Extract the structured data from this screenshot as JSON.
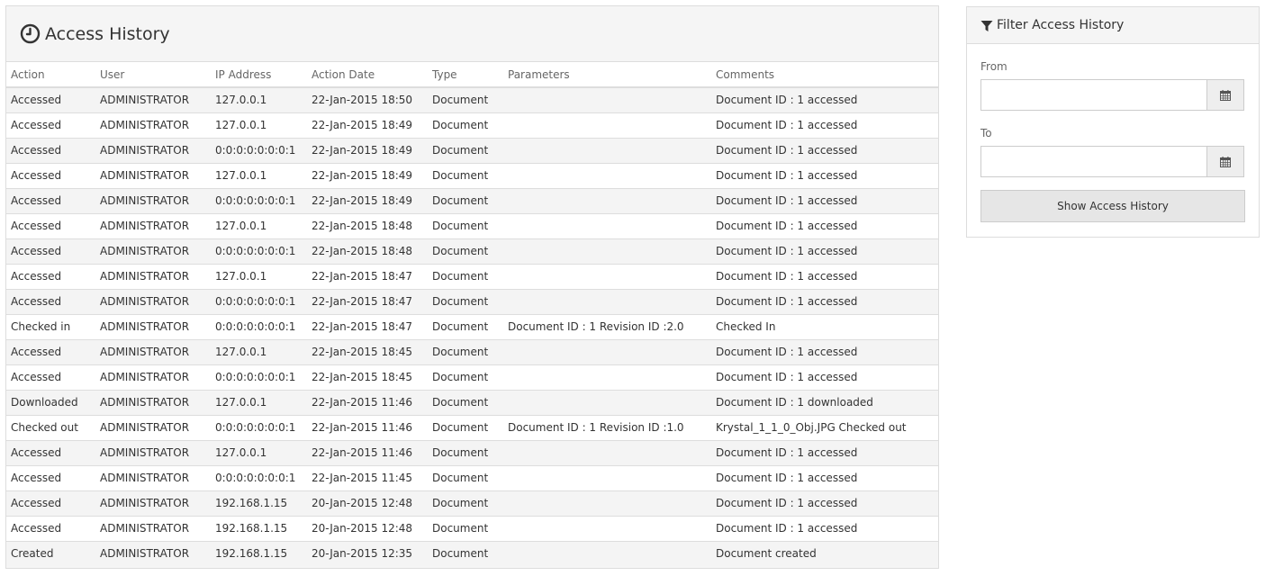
{
  "history": {
    "title": "Access History",
    "columns": [
      "Action",
      "User",
      "IP Address",
      "Action Date",
      "Type",
      "Parameters",
      "Comments"
    ],
    "rows": [
      [
        "Accessed",
        "ADMINISTRATOR",
        "127.0.0.1",
        "22-Jan-2015 18:50",
        "Document",
        "",
        "Document ID : 1 accessed"
      ],
      [
        "Accessed",
        "ADMINISTRATOR",
        "127.0.0.1",
        "22-Jan-2015 18:49",
        "Document",
        "",
        "Document ID : 1 accessed"
      ],
      [
        "Accessed",
        "ADMINISTRATOR",
        "0:0:0:0:0:0:0:1",
        "22-Jan-2015 18:49",
        "Document",
        "",
        "Document ID : 1 accessed"
      ],
      [
        "Accessed",
        "ADMINISTRATOR",
        "127.0.0.1",
        "22-Jan-2015 18:49",
        "Document",
        "",
        "Document ID : 1 accessed"
      ],
      [
        "Accessed",
        "ADMINISTRATOR",
        "0:0:0:0:0:0:0:1",
        "22-Jan-2015 18:49",
        "Document",
        "",
        "Document ID : 1 accessed"
      ],
      [
        "Accessed",
        "ADMINISTRATOR",
        "127.0.0.1",
        "22-Jan-2015 18:48",
        "Document",
        "",
        "Document ID : 1 accessed"
      ],
      [
        "Accessed",
        "ADMINISTRATOR",
        "0:0:0:0:0:0:0:1",
        "22-Jan-2015 18:48",
        "Document",
        "",
        "Document ID : 1 accessed"
      ],
      [
        "Accessed",
        "ADMINISTRATOR",
        "127.0.0.1",
        "22-Jan-2015 18:47",
        "Document",
        "",
        "Document ID : 1 accessed"
      ],
      [
        "Accessed",
        "ADMINISTRATOR",
        "0:0:0:0:0:0:0:1",
        "22-Jan-2015 18:47",
        "Document",
        "",
        "Document ID : 1 accessed"
      ],
      [
        "Checked in",
        "ADMINISTRATOR",
        "0:0:0:0:0:0:0:1",
        "22-Jan-2015 18:47",
        "Document",
        "Document ID : 1 Revision ID :2.0",
        "Checked In"
      ],
      [
        "Accessed",
        "ADMINISTRATOR",
        "127.0.0.1",
        "22-Jan-2015 18:45",
        "Document",
        "",
        "Document ID : 1 accessed"
      ],
      [
        "Accessed",
        "ADMINISTRATOR",
        "0:0:0:0:0:0:0:1",
        "22-Jan-2015 18:45",
        "Document",
        "",
        "Document ID : 1 accessed"
      ],
      [
        "Downloaded",
        "ADMINISTRATOR",
        "127.0.0.1",
        "22-Jan-2015 11:46",
        "Document",
        "",
        "Document ID : 1 downloaded"
      ],
      [
        "Checked out",
        "ADMINISTRATOR",
        "0:0:0:0:0:0:0:1",
        "22-Jan-2015 11:46",
        "Document",
        "Document ID : 1 Revision ID :1.0",
        "Krystal_1_1_0_Obj.JPG Checked out"
      ],
      [
        "Accessed",
        "ADMINISTRATOR",
        "127.0.0.1",
        "22-Jan-2015 11:46",
        "Document",
        "",
        "Document ID : 1 accessed"
      ],
      [
        "Accessed",
        "ADMINISTRATOR",
        "0:0:0:0:0:0:0:1",
        "22-Jan-2015 11:45",
        "Document",
        "",
        "Document ID : 1 accessed"
      ],
      [
        "Accessed",
        "ADMINISTRATOR",
        "192.168.1.15",
        "20-Jan-2015 12:48",
        "Document",
        "",
        "Document ID : 1 accessed"
      ],
      [
        "Accessed",
        "ADMINISTRATOR",
        "192.168.1.15",
        "20-Jan-2015 12:48",
        "Document",
        "",
        "Document ID : 1 accessed"
      ],
      [
        "Created",
        "ADMINISTRATOR",
        "192.168.1.15",
        "20-Jan-2015 12:35",
        "Document",
        "",
        "Document created"
      ]
    ]
  },
  "filter": {
    "title": "Filter Access History",
    "from_label": "From",
    "from_value": "",
    "to_label": "To",
    "to_value": "",
    "button_label": "Show Access History"
  },
  "icons": {
    "header": "clock-icon",
    "filter": "filter-icon",
    "date_picker": "calendar-icon"
  }
}
